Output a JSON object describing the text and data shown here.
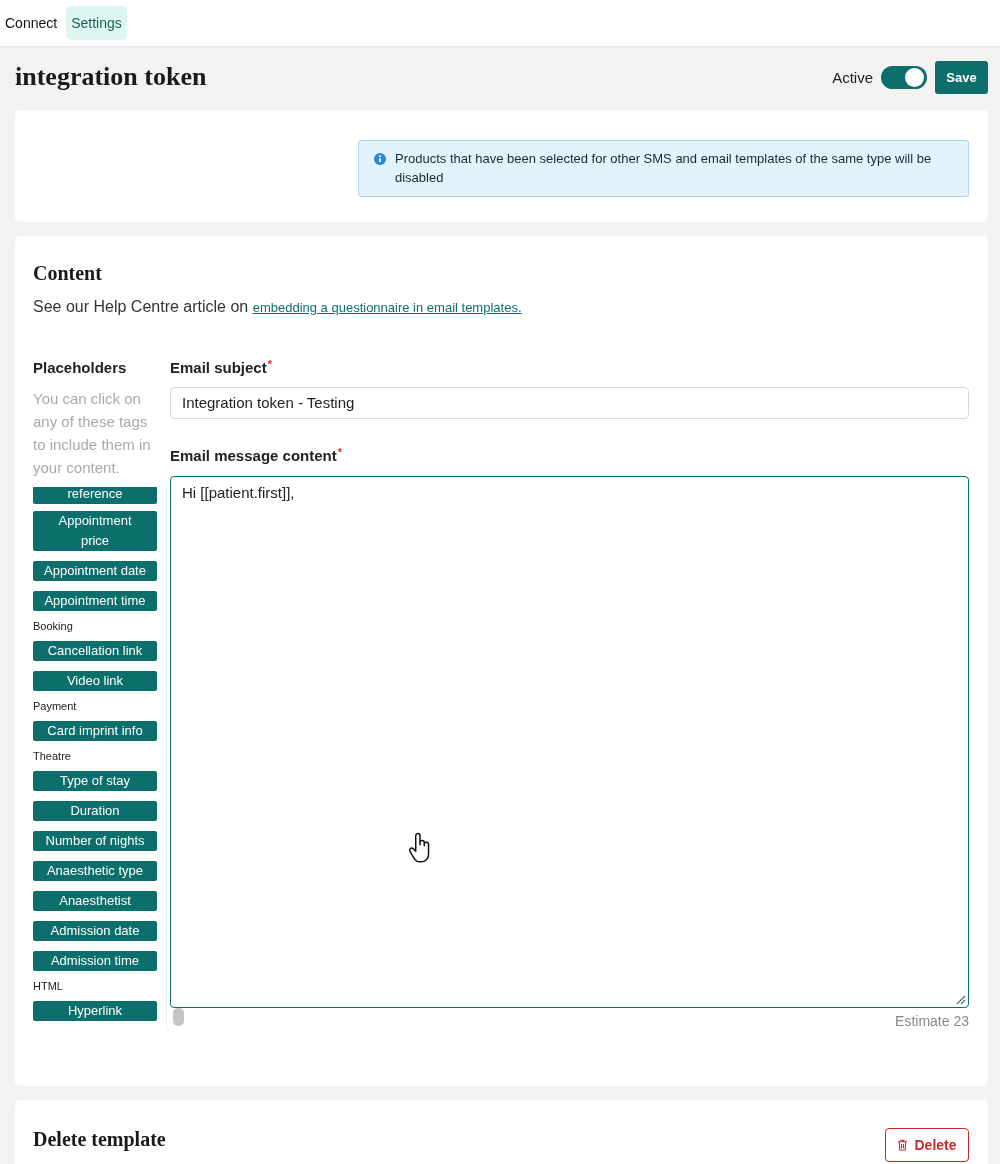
{
  "nav": {
    "tabs": [
      {
        "label": "Connect",
        "selected": false
      },
      {
        "label": "Settings",
        "selected": true
      }
    ]
  },
  "header": {
    "title": "integration token",
    "active_toggle": {
      "label": "Active",
      "on": true
    },
    "save_button": "Save"
  },
  "products_card": {
    "info_banner": "Products that have been selected for other SMS and email templates of the same type will be disabled"
  },
  "content_card": {
    "title": "Content",
    "help_text": "See our Help Centre article on",
    "help_link": "embedding a questionnaire in email templates.",
    "placeholders": {
      "title": "Placeholders",
      "hint": "You can click on any of these tags to include them in your content.",
      "items": [
        {
          "kind": "tag",
          "label": "reference",
          "clipped": true
        },
        {
          "kind": "tag",
          "label": "Appointment price",
          "clipped": false
        },
        {
          "kind": "tag",
          "label": "Appointment date",
          "clipped": false
        },
        {
          "kind": "tag",
          "label": "Appointment time",
          "clipped": false
        },
        {
          "kind": "group",
          "label": "Booking"
        },
        {
          "kind": "tag",
          "label": "Cancellation link",
          "clipped": false
        },
        {
          "kind": "tag",
          "label": "Video link",
          "clipped": false
        },
        {
          "kind": "group",
          "label": "Payment"
        },
        {
          "kind": "tag",
          "label": "Card imprint info",
          "clipped": false
        },
        {
          "kind": "group",
          "label": "Theatre"
        },
        {
          "kind": "tag",
          "label": "Type of stay",
          "clipped": false
        },
        {
          "kind": "tag",
          "label": "Duration",
          "clipped": false
        },
        {
          "kind": "tag",
          "label": "Number of nights",
          "clipped": false
        },
        {
          "kind": "tag",
          "label": "Anaesthetic type",
          "clipped": false
        },
        {
          "kind": "tag",
          "label": "Anaesthetist",
          "clipped": false
        },
        {
          "kind": "tag",
          "label": "Admission date",
          "clipped": false
        },
        {
          "kind": "tag",
          "label": "Admission time",
          "clipped": false
        },
        {
          "kind": "group",
          "label": "HTML"
        },
        {
          "kind": "tag",
          "label": "Hyperlink",
          "clipped": false
        }
      ]
    },
    "email_subject": {
      "label": "Email subject",
      "required_mark": "*",
      "value": "Integration token - Testing"
    },
    "email_message": {
      "label": "Email message content",
      "required_mark": "*",
      "value": "Hi [[patient.first]],",
      "focused": true
    },
    "estimate": "Estimate 23"
  },
  "delete_card": {
    "title": "Delete template",
    "delete_button": "Delete"
  }
}
